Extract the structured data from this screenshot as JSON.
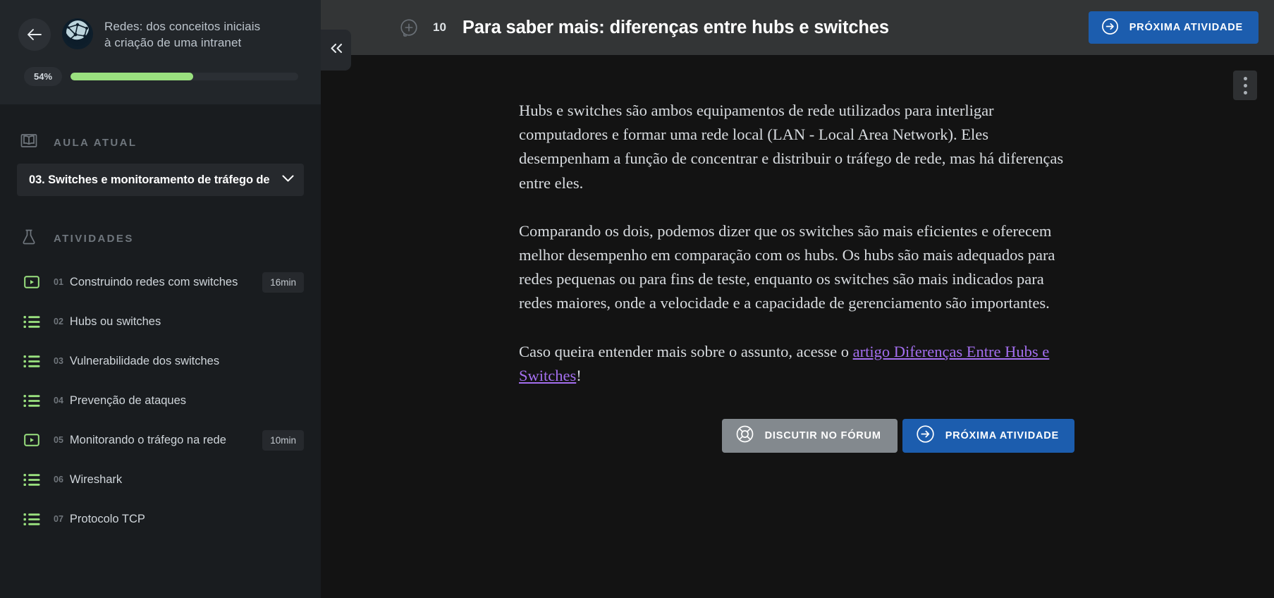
{
  "sidebar": {
    "back_icon": "arrow-left-icon",
    "course_logo_icon": "network-graph-icon",
    "course_title": "Redes: dos conceitos iniciais à criação de uma intranet",
    "progress_percent_label": "54%",
    "progress_percent_value": 54,
    "collapse_icon": "chevrons-left-icon",
    "current_lesson_section": {
      "icon": "open-book-icon",
      "label": "AULA ATUAL",
      "selected_lesson": "03. Switches e monitoramento de tráfego de",
      "chevron_icon": "chevron-down-icon"
    },
    "activities_section": {
      "icon": "flask-icon",
      "label": "ATIVIDADES"
    },
    "activities": [
      {
        "num": "01",
        "label": "Construindo redes com switches",
        "icon": "video-play-icon",
        "duration": "16min"
      },
      {
        "num": "02",
        "label": "Hubs ou switches",
        "icon": "list-icon",
        "duration": ""
      },
      {
        "num": "03",
        "label": "Vulnerabilidade dos switches",
        "icon": "list-icon",
        "duration": ""
      },
      {
        "num": "04",
        "label": "Prevenção de ataques",
        "icon": "list-icon",
        "duration": ""
      },
      {
        "num": "05",
        "label": "Monitorando o tráfego na rede",
        "icon": "video-play-icon",
        "duration": "10min"
      },
      {
        "num": "06",
        "label": "Wireshark",
        "icon": "list-icon",
        "duration": ""
      },
      {
        "num": "07",
        "label": "Protocolo TCP",
        "icon": "list-icon",
        "duration": ""
      }
    ]
  },
  "header": {
    "annotation_icon": "add-comment-icon",
    "activity_index": "10",
    "title": "Para saber mais: diferenças entre hubs e switches",
    "next_button_label": "PRÓXIMA ATIVIDADE",
    "next_button_icon": "arrow-right-circle-icon",
    "kebab_icon": "more-vertical-icon"
  },
  "content": {
    "paragraph_1": "Hubs e switches são ambos equipamentos de rede utilizados para interligar computadores e formar uma rede local (LAN - Local Area Network). Eles desempenham a função de concentrar e distribuir o tráfego de rede, mas há diferenças entre eles.",
    "paragraph_2": "Comparando os dois, podemos dizer que os switches são mais eficientes e oferecem melhor desempenho em comparação com os hubs. Os hubs são mais adequados para redes pequenas ou para fins de teste, enquanto os switches são mais indicados para redes maiores, onde a velocidade e a capacidade de gerenciamento são importantes.",
    "paragraph_3_before": "Caso queira entender mais sobre o assunto, acesse o ",
    "paragraph_3_link": "artigo Diferenças Entre Hubs e Switches",
    "paragraph_3_after": "!"
  },
  "footer": {
    "forum_button_label": "DISCUTIR NO FÓRUM",
    "forum_button_icon": "lifebuoy-icon",
    "next_button_label": "PRÓXIMA ATIVIDADE",
    "next_button_icon": "arrow-right-circle-icon"
  },
  "colors": {
    "accent_blue": "#1c5dae",
    "progress_green": "#9ae17f",
    "activity_icon_green": "#9ae17f",
    "link_purple": "#a46ff0",
    "sidebar_bg": "#191c1f",
    "sidebar_header_bg": "#22262a",
    "content_bg": "#131313",
    "main_header_bg": "#333536",
    "forum_gray": "#83898e"
  }
}
